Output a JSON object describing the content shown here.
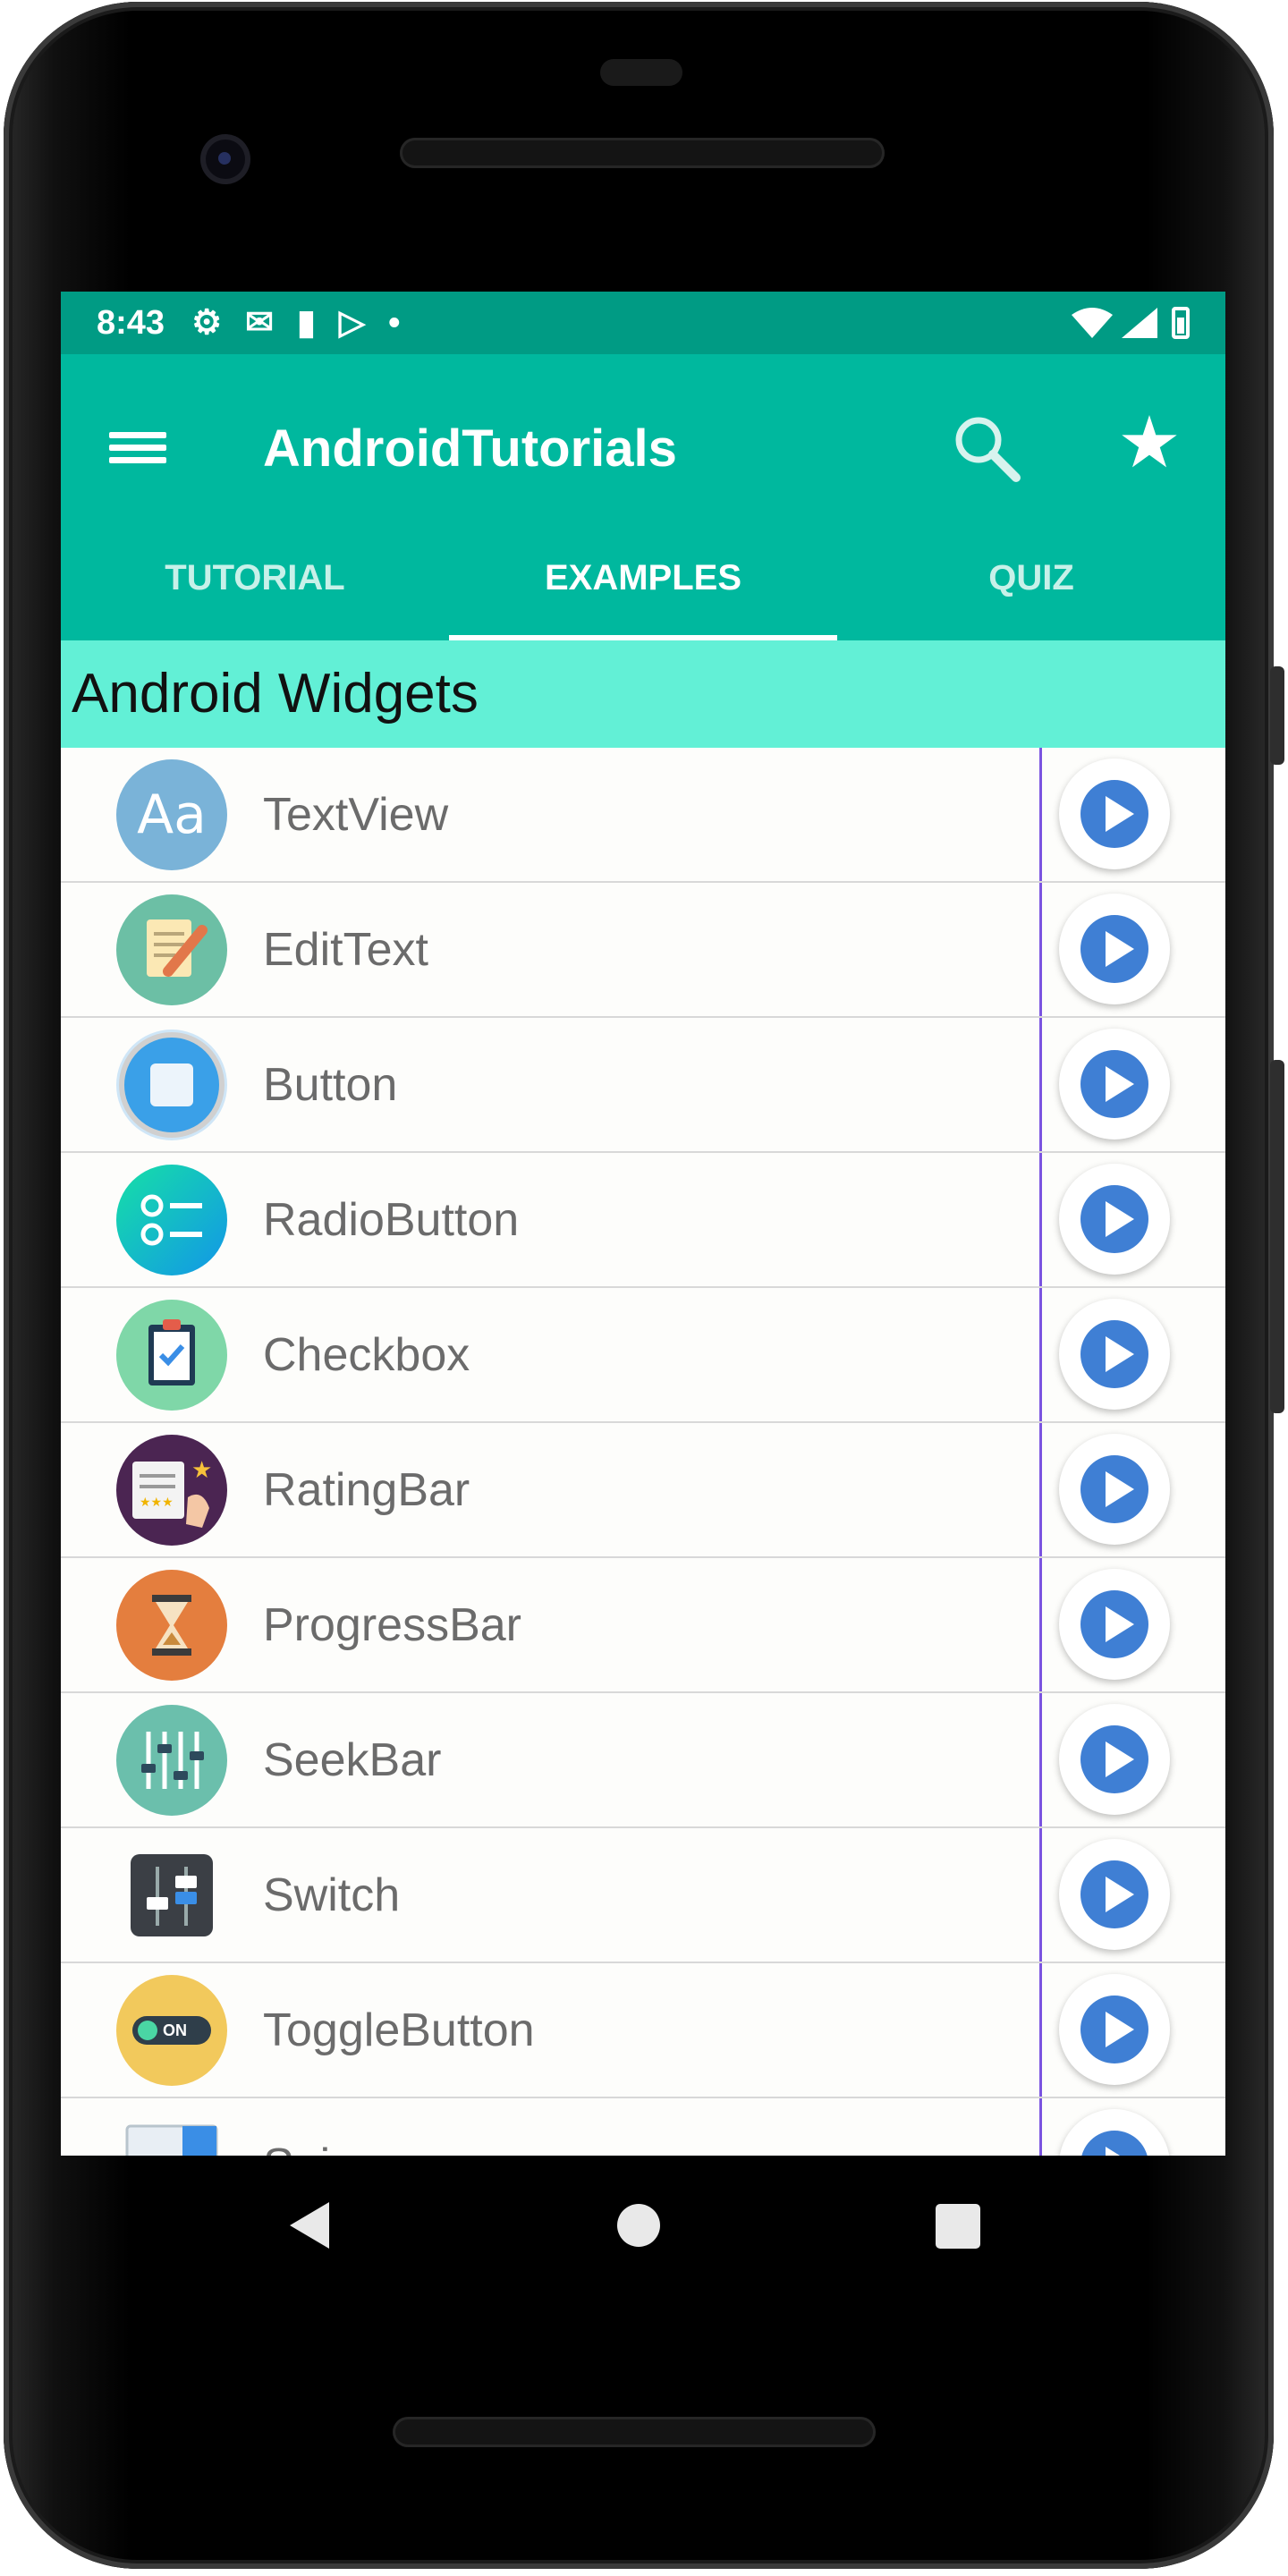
{
  "status_bar": {
    "time": "8:43",
    "left_icons": [
      "gear-icon",
      "mail-icon",
      "sd-card-icon",
      "play-store-icon",
      "dot-icon"
    ],
    "right_icons": [
      "wifi-icon",
      "signal-icon",
      "battery-icon"
    ]
  },
  "app_bar": {
    "title": "AndroidTutorials"
  },
  "tabs": [
    {
      "label": "TUTORIAL"
    },
    {
      "label": "EXAMPLES"
    },
    {
      "label": "QUIZ"
    }
  ],
  "active_tab": "EXAMPLES",
  "section": {
    "title": "Android Widgets"
  },
  "items": [
    {
      "label": "TextView",
      "icon": "textview-icon"
    },
    {
      "label": "EditText",
      "icon": "edittext-icon"
    },
    {
      "label": "Button",
      "icon": "button-icon"
    },
    {
      "label": "RadioButton",
      "icon": "radiobutton-icon"
    },
    {
      "label": "Checkbox",
      "icon": "checkbox-icon"
    },
    {
      "label": "RatingBar",
      "icon": "ratingbar-icon"
    },
    {
      "label": "ProgressBar",
      "icon": "progressbar-icon"
    },
    {
      "label": "SeekBar",
      "icon": "seekbar-icon"
    },
    {
      "label": "Switch",
      "icon": "switch-icon"
    },
    {
      "label": "ToggleButton",
      "icon": "togglebutton-icon"
    },
    {
      "label": "Spinner",
      "icon": "spinner-icon"
    }
  ],
  "icon_text": {
    "textview": "Aa",
    "toggle": "ON"
  },
  "colors": {
    "status_bar": "#009b84",
    "app_bar": "#00b89e",
    "section_header": "#62f0d6",
    "play_button": "#3f7fd4",
    "divider": "#7b54e0"
  }
}
